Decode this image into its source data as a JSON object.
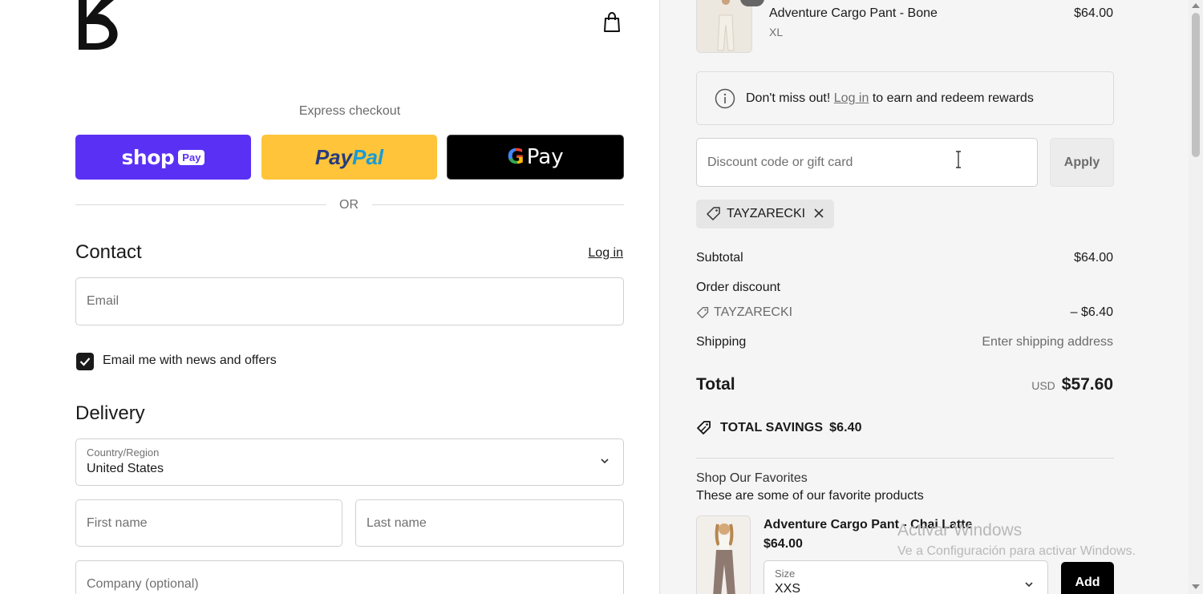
{
  "header": {
    "logo_icon": "brand-logo-icon",
    "cart_icon": "shopping-bag-icon"
  },
  "express": {
    "title": "Express checkout",
    "shop_pay": {
      "word": "shop",
      "badge": "Pay"
    },
    "paypal": {
      "part1": "Pay",
      "part2": "Pal"
    },
    "gpay": {
      "g": "G",
      "label": "Pay"
    },
    "or_label": "OR"
  },
  "contact": {
    "title": "Contact",
    "login_label": "Log in",
    "email_placeholder": "Email",
    "newsletter_label": "Email me with news and offers",
    "newsletter_checked": true
  },
  "delivery": {
    "title": "Delivery",
    "country_label": "Country/Region",
    "country_value": "United States",
    "first_name_placeholder": "First name",
    "last_name_placeholder": "Last name",
    "company_placeholder": "Company (optional)"
  },
  "summary": {
    "item": {
      "name": "Adventure Cargo Pant - Bone",
      "variant": "XL",
      "price": "$64.00"
    },
    "notice": {
      "before": "Don't miss out!",
      "link": "Log in",
      "after": "to earn and redeem rewards",
      "icon": "info-icon"
    },
    "discount_placeholder": "Discount code or gift card",
    "apply_label": "Apply",
    "applied_code": "TAYZARECKI",
    "subtotal_label": "Subtotal",
    "subtotal_value": "$64.00",
    "order_discount_label": "Order discount",
    "discount_code": "TAYZARECKI",
    "discount_value": "– $6.40",
    "shipping_label": "Shipping",
    "shipping_value": "Enter shipping address",
    "total_label": "Total",
    "total_currency": "USD",
    "total_value": "$57.60",
    "savings_label": "TOTAL SAVINGS",
    "savings_value": "$6.40"
  },
  "favorites": {
    "title": "Shop Our Favorites",
    "subtitle": "These are some of our favorite products",
    "product": {
      "name": "Adventure Cargo Pant - Chai Latte",
      "price": "$64.00",
      "size_label": "Size",
      "size_value": "XXS"
    },
    "add_label": "Add"
  },
  "watermark": {
    "line1": "Activar Windows",
    "line2": "Ve a Configuración para activar Windows."
  },
  "colors": {
    "shop_pay": "#5a31f4",
    "paypal": "#ffc439",
    "gpay": "#000000",
    "summary_bg": "#f5f5f5"
  }
}
